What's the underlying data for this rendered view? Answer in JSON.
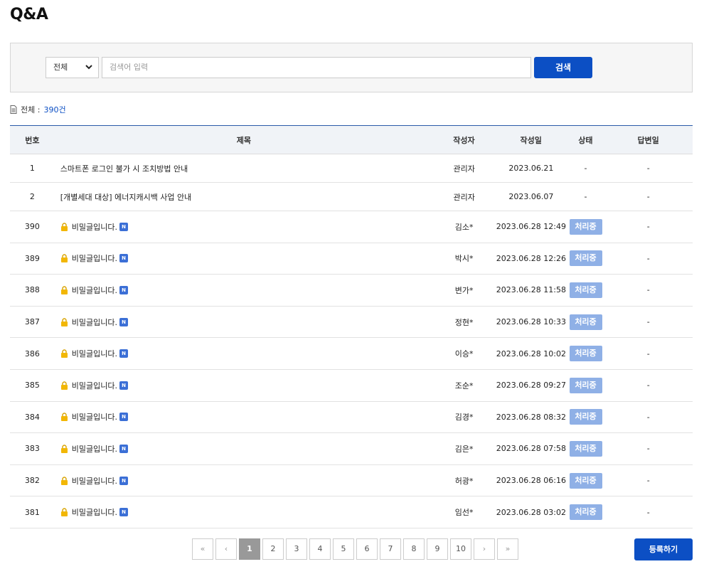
{
  "page": {
    "title": "Q&A"
  },
  "search": {
    "category_selected": "전체",
    "placeholder": "검색어 입력",
    "button_label": "검색"
  },
  "summary": {
    "total_label": "전체 :",
    "total_count": "390",
    "unit": "건"
  },
  "table": {
    "headers": {
      "no": "번호",
      "title": "제목",
      "writer": "작성자",
      "date": "작성일",
      "status": "상태",
      "answer_date": "답변일"
    },
    "notices": [
      {
        "no": "1",
        "title": "스마트폰 로그인 불가 시 조치방법 안내",
        "writer": "관리자",
        "date": "2023.06.21",
        "status": "-",
        "answer_date": "-"
      },
      {
        "no": "2",
        "title": "[개별세대 대상] 에너지캐시백 사업 안내",
        "writer": "관리자",
        "date": "2023.06.07",
        "status": "-",
        "answer_date": "-"
      }
    ],
    "posts": [
      {
        "no": "390",
        "title": "비밀글입니다.",
        "badge": "N",
        "writer": "김소*",
        "date": "2023.06.28 12:49",
        "status": "처리중",
        "answer_date": "-"
      },
      {
        "no": "389",
        "title": "비밀글입니다.",
        "badge": "N",
        "writer": "박시*",
        "date": "2023.06.28 12:26",
        "status": "처리중",
        "answer_date": "-"
      },
      {
        "no": "388",
        "title": "비밀글입니다.",
        "badge": "N",
        "writer": "변가*",
        "date": "2023.06.28 11:58",
        "status": "처리중",
        "answer_date": "-"
      },
      {
        "no": "387",
        "title": "비밀글입니다.",
        "badge": "N",
        "writer": "정현*",
        "date": "2023.06.28 10:33",
        "status": "처리중",
        "answer_date": "-"
      },
      {
        "no": "386",
        "title": "비밀글입니다.",
        "badge": "N",
        "writer": "이승*",
        "date": "2023.06.28 10:02",
        "status": "처리중",
        "answer_date": "-"
      },
      {
        "no": "385",
        "title": "비밀글입니다.",
        "badge": "N",
        "writer": "조순*",
        "date": "2023.06.28 09:27",
        "status": "처리중",
        "answer_date": "-"
      },
      {
        "no": "384",
        "title": "비밀글입니다.",
        "badge": "N",
        "writer": "김경*",
        "date": "2023.06.28 08:32",
        "status": "처리중",
        "answer_date": "-"
      },
      {
        "no": "383",
        "title": "비밀글입니다.",
        "badge": "N",
        "writer": "김은*",
        "date": "2023.06.28 07:58",
        "status": "처리중",
        "answer_date": "-"
      },
      {
        "no": "382",
        "title": "비밀글입니다.",
        "badge": "N",
        "writer": "허광*",
        "date": "2023.06.28 06:16",
        "status": "처리중",
        "answer_date": "-"
      },
      {
        "no": "381",
        "title": "비밀글입니다.",
        "badge": "N",
        "writer": "임선*",
        "date": "2023.06.28 03:02",
        "status": "처리중",
        "answer_date": "-"
      }
    ]
  },
  "pagination": {
    "first": "«",
    "prev": "‹",
    "pages": [
      "1",
      "2",
      "3",
      "4",
      "5",
      "6",
      "7",
      "8",
      "9",
      "10"
    ],
    "current": "1",
    "next": "›",
    "last": "»"
  },
  "actions": {
    "register_label": "등록하기"
  },
  "colors": {
    "primary": "#0c4fc4",
    "status_badge": "#8fb0e6",
    "new_badge": "#3b6fd6",
    "lock": "#f2b705"
  },
  "icons": {
    "lock": "lock-icon",
    "new": "new-badge",
    "doc": "document-icon",
    "select": "chevron-down-icon"
  }
}
